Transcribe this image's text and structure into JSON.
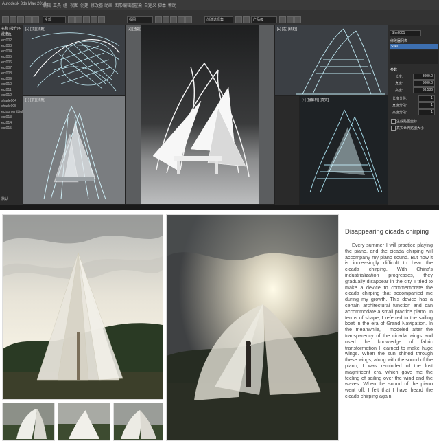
{
  "app": {
    "menu": [
      "Autodesk 3ds Max 2018",
      "编辑",
      "工具",
      "组",
      "视图",
      "创建",
      "修改器",
      "动画",
      "图形编辑器",
      "渲染",
      "自定义",
      "脚本",
      "帮助"
    ],
    "toolbar": {
      "select_label": "全部",
      "view_label": "视图",
      "selection_set": "创建选择集",
      "product_field": "产品级"
    },
    "scene_list": {
      "header": "名称 (按升序排序)",
      "items": [
        "ect001",
        "ect002",
        "ect003",
        "ect004",
        "ect005",
        "ect006",
        "ect007",
        "ect008",
        "ect009",
        "ect010",
        "ect011",
        "ect012",
        "shade004",
        "shade005",
        "ectoomentLight01",
        "ect013",
        "ect014",
        "ect015"
      ],
      "footer": "默认"
    },
    "viewports": {
      "top": "[+] [顶] [线框]",
      "front": "[+] [前] [线框]",
      "left": "[+] [左] [线框]",
      "persp": "[+] [透视] [默认明暗处理]",
      "camera": "[+] [摄影机] [真实]"
    },
    "right_panel": {
      "modifier_label": "Shell001",
      "modifier_list_label": "修改器列表",
      "modifier_item": "Ssel",
      "params_header": "参数",
      "fields": [
        {
          "label": "长度:",
          "value": "3000.0"
        },
        {
          "label": "宽度:",
          "value": "3000.0"
        },
        {
          "label": "高度:",
          "value": "38.586"
        },
        {
          "label": "长度分段:",
          "value": "1"
        },
        {
          "label": "宽度分段:",
          "value": "1"
        },
        {
          "label": "高度分段:",
          "value": "1"
        }
      ],
      "checkbox1": "生成贴图坐标",
      "checkbox2": "真实世界贴图大小"
    }
  },
  "article": {
    "title": "Disappearing cicada chirping",
    "body": "Every summer I will practice playing the piano, and the cicada chirping will accompany my piano sound. But now it is increasingly difficult to hear the cicada chirping. With China's industrialization progresses, they gradually disappear in the city. I tried to make a device to commemorate the cicada chirping that accompanied me during my growth. This device has a certain architectural function and can accommodate a small practice piano. In terms of shape, I referred to the sailing boat in the era of Grand Navigation. In the meanwhile, I modeled after the transparency of the cicada wings and used the knowledge of fabric transformation I learned to make huge wings. When the sun shined through these wings, along with the sound of the piano, I was reminded of the lost magnificent era, which gave me the feeling of sailing over the wind and the waves. When the sound of the piano went off, I felt that I have heard the cicada chirping again."
  },
  "colors": {
    "viewport_bg": "#3b3f44",
    "wire_color": "#bfe8f2",
    "selected_wire": "#ffffff",
    "ui_dark": "#2a2a2a",
    "accent_blue": "#3d6fb0"
  }
}
